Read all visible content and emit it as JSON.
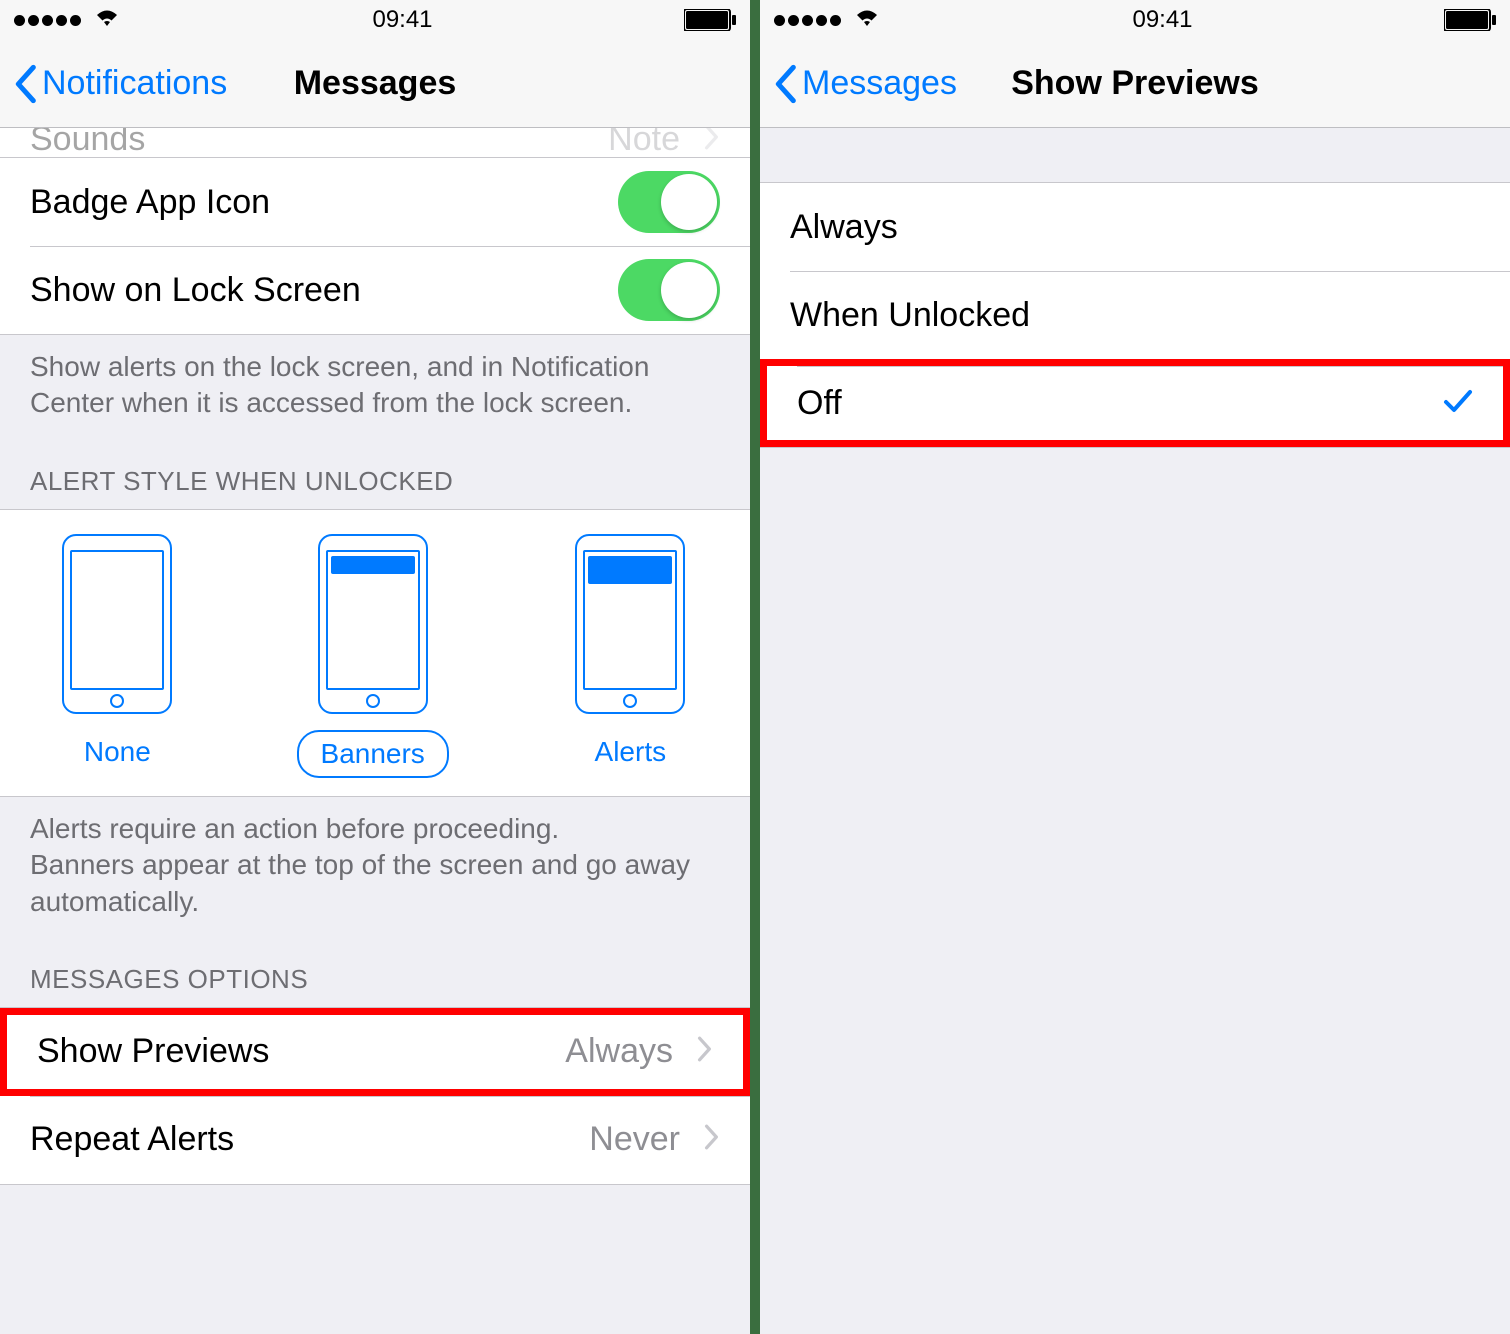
{
  "status": {
    "time": "09:41"
  },
  "left": {
    "back_label": "Notifications",
    "title": "Messages",
    "peek_row": {
      "label": "Sounds",
      "value": "Note"
    },
    "rows": {
      "badge": "Badge App Icon",
      "lock": "Show on Lock Screen"
    },
    "lock_footer": "Show alerts on the lock screen, and in Notification Center when it is accessed from the lock screen.",
    "alert_header": "ALERT STYLE WHEN UNLOCKED",
    "alert_styles": {
      "none": "None",
      "banners": "Banners",
      "alerts": "Alerts"
    },
    "alert_footer": "Alerts require an action before proceeding.\nBanners appear at the top of the screen and go away automatically.",
    "options_header": "MESSAGES OPTIONS",
    "options": {
      "previews_label": "Show Previews",
      "previews_value": "Always",
      "repeat_label": "Repeat Alerts",
      "repeat_value": "Never"
    }
  },
  "right": {
    "back_label": "Messages",
    "title": "Show Previews",
    "options": {
      "always": "Always",
      "unlocked": "When Unlocked",
      "off": "Off"
    }
  }
}
